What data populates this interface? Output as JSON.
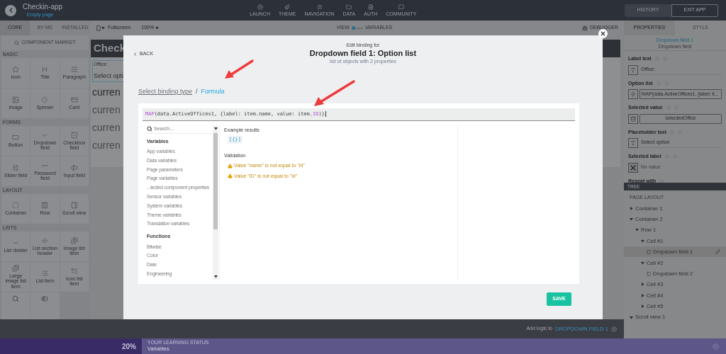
{
  "app": {
    "title": "Checkin-app",
    "page": "Empty page"
  },
  "nav": [
    {
      "label": "LAUNCH"
    },
    {
      "label": "THEME"
    },
    {
      "label": "NAVIGATION"
    },
    {
      "label": "DATA"
    },
    {
      "label": "AUTH"
    },
    {
      "label": "COMMUNITY"
    }
  ],
  "header_buttons": [
    {
      "label": "HISTORY",
      "kind": "filled"
    },
    {
      "label": "EXIT APP",
      "kind": "outlined"
    }
  ],
  "component_tabs": [
    {
      "label": "CORE",
      "selected": true
    },
    {
      "label": "BY ME",
      "selected": false
    },
    {
      "label": "INSTALLED",
      "selected": false
    }
  ],
  "component_market": "COMPONENT MARKET",
  "component_sections": [
    {
      "title": "BASIC",
      "items": [
        "Icon",
        "Title",
        "Paragraph",
        "Image",
        "Spinner",
        "Card"
      ]
    },
    {
      "title": "FORMS",
      "items": [
        "Button",
        "Dropdown field",
        "Checkbox field",
        "Slider field",
        "Password field",
        "Input field"
      ]
    },
    {
      "title": "LAYOUT",
      "items": [
        "Container",
        "Row",
        "Scroll view"
      ]
    },
    {
      "title": "LISTS",
      "items": [
        "List divider",
        "List section header",
        "Image list item",
        "Large image list item",
        "List item",
        "Icon list item"
      ]
    }
  ],
  "toolbar": {
    "device": "Fullscreen",
    "zoom": "100%",
    "view_label": "VIEW",
    "variables_label": "VARIABLES",
    "variables_on": false,
    "debugger": "DEBUGGER"
  },
  "preview": {
    "header": "Check",
    "label": "Office:",
    "field": "Select opti",
    "rows": [
      "curren",
      "curren",
      "curren",
      "curren"
    ]
  },
  "bottom_bar": {
    "prefix": "Add logic to",
    "target": "DROPDOWN FIELD 1"
  },
  "learning": {
    "percent": "20%",
    "title": "YOUR LEARNING STATUS",
    "topic": "Variables"
  },
  "properties_tabs": [
    {
      "label": "PROPERTIES",
      "selected": true
    },
    {
      "label": "STYLE",
      "selected": false
    }
  ],
  "selected_component": {
    "name": "Dropdown field 1",
    "type": "Dropdown field"
  },
  "properties": [
    {
      "label": "Label text",
      "kind": "text",
      "value": "Office:"
    },
    {
      "label": "Option list",
      "kind": "formula",
      "value": "MAP(data.ActiveOffices1, {label: it..."
    },
    {
      "label": "Selected value",
      "kind": "variable",
      "value": "selectedOffice"
    },
    {
      "label": "Placeholder text",
      "kind": "text",
      "value": "Select option"
    },
    {
      "label": "Selected label",
      "kind": "none",
      "value": "No value"
    },
    {
      "label": "Repeat with",
      "kind": "empty"
    }
  ],
  "tree": {
    "title": "TREE",
    "section": "PAGE LAYOUT",
    "items": [
      {
        "label": "Container 1",
        "expanded": false,
        "selected": false
      },
      {
        "label": "Container 2",
        "expanded": true,
        "selected": false,
        "children": [
          {
            "label": "Row 1",
            "expanded": true,
            "selected": false,
            "children": [
              {
                "label": "Cell #1",
                "expanded": true,
                "selected": false,
                "children": [
                  {
                    "label": "Dropdown field 1",
                    "kind": "component",
                    "selected": true
                  }
                ]
              },
              {
                "label": "Cell #2",
                "expanded": true,
                "selected": false,
                "children": [
                  {
                    "label": "Dropdown field 2",
                    "kind": "component",
                    "selected": false
                  }
                ]
              },
              {
                "label": "Cell #3",
                "expanded": false,
                "selected": false
              },
              {
                "label": "Cell #4",
                "expanded": false,
                "selected": false
              },
              {
                "label": "Cell #5",
                "expanded": false,
                "selected": false
              }
            ]
          }
        ]
      },
      {
        "label": "Scroll view 1",
        "expanded": true,
        "selected": false
      }
    ]
  },
  "dialog": {
    "back": "BACK",
    "subtitle": "Edit binding for",
    "title": "Dropdown field 1: Option list",
    "description": "list of objects with 2 properties",
    "breadcrumb_separator": "/",
    "breadcrumb": [
      {
        "label": "Select binding type",
        "selected": false
      },
      {
        "label": "Formula",
        "selected": true
      }
    ],
    "formula": [
      {
        "text": "MAP",
        "kind": "function"
      },
      {
        "text": "(data.ActiveOffices1, {label: item.name, value: item.",
        "kind": "plain"
      },
      {
        "text": "ID",
        "kind": "function"
      },
      {
        "text": ")}",
        "kind": "plain"
      }
    ],
    "search_placeholder": "Search...",
    "groups": [
      {
        "title": "Variables",
        "items": [
          {
            "label": "App variables"
          },
          {
            "label": "Data variables"
          },
          {
            "label": "Page parameters"
          },
          {
            "label": "Page variables"
          },
          {
            "label": "...lected component properties"
          },
          {
            "label": "Sensor variables"
          },
          {
            "label": "System variables"
          },
          {
            "label": "Theme variables"
          },
          {
            "label": "Translation variables"
          }
        ]
      },
      {
        "title": "Functions",
        "items": [
          {
            "label": "Bitwise"
          },
          {
            "label": "Color"
          },
          {
            "label": "Date"
          },
          {
            "label": "Engineering"
          }
        ]
      }
    ],
    "example_title": "Example results",
    "example_value": "[{}]",
    "validation_title": "Validation",
    "messages": [
      {
        "kind": "warning",
        "text": "Value \"name\" is not equal to \"id\""
      },
      {
        "kind": "warning",
        "text": "Value \"ID\" is not equal to \"id\""
      }
    ],
    "save": "SAVE"
  }
}
